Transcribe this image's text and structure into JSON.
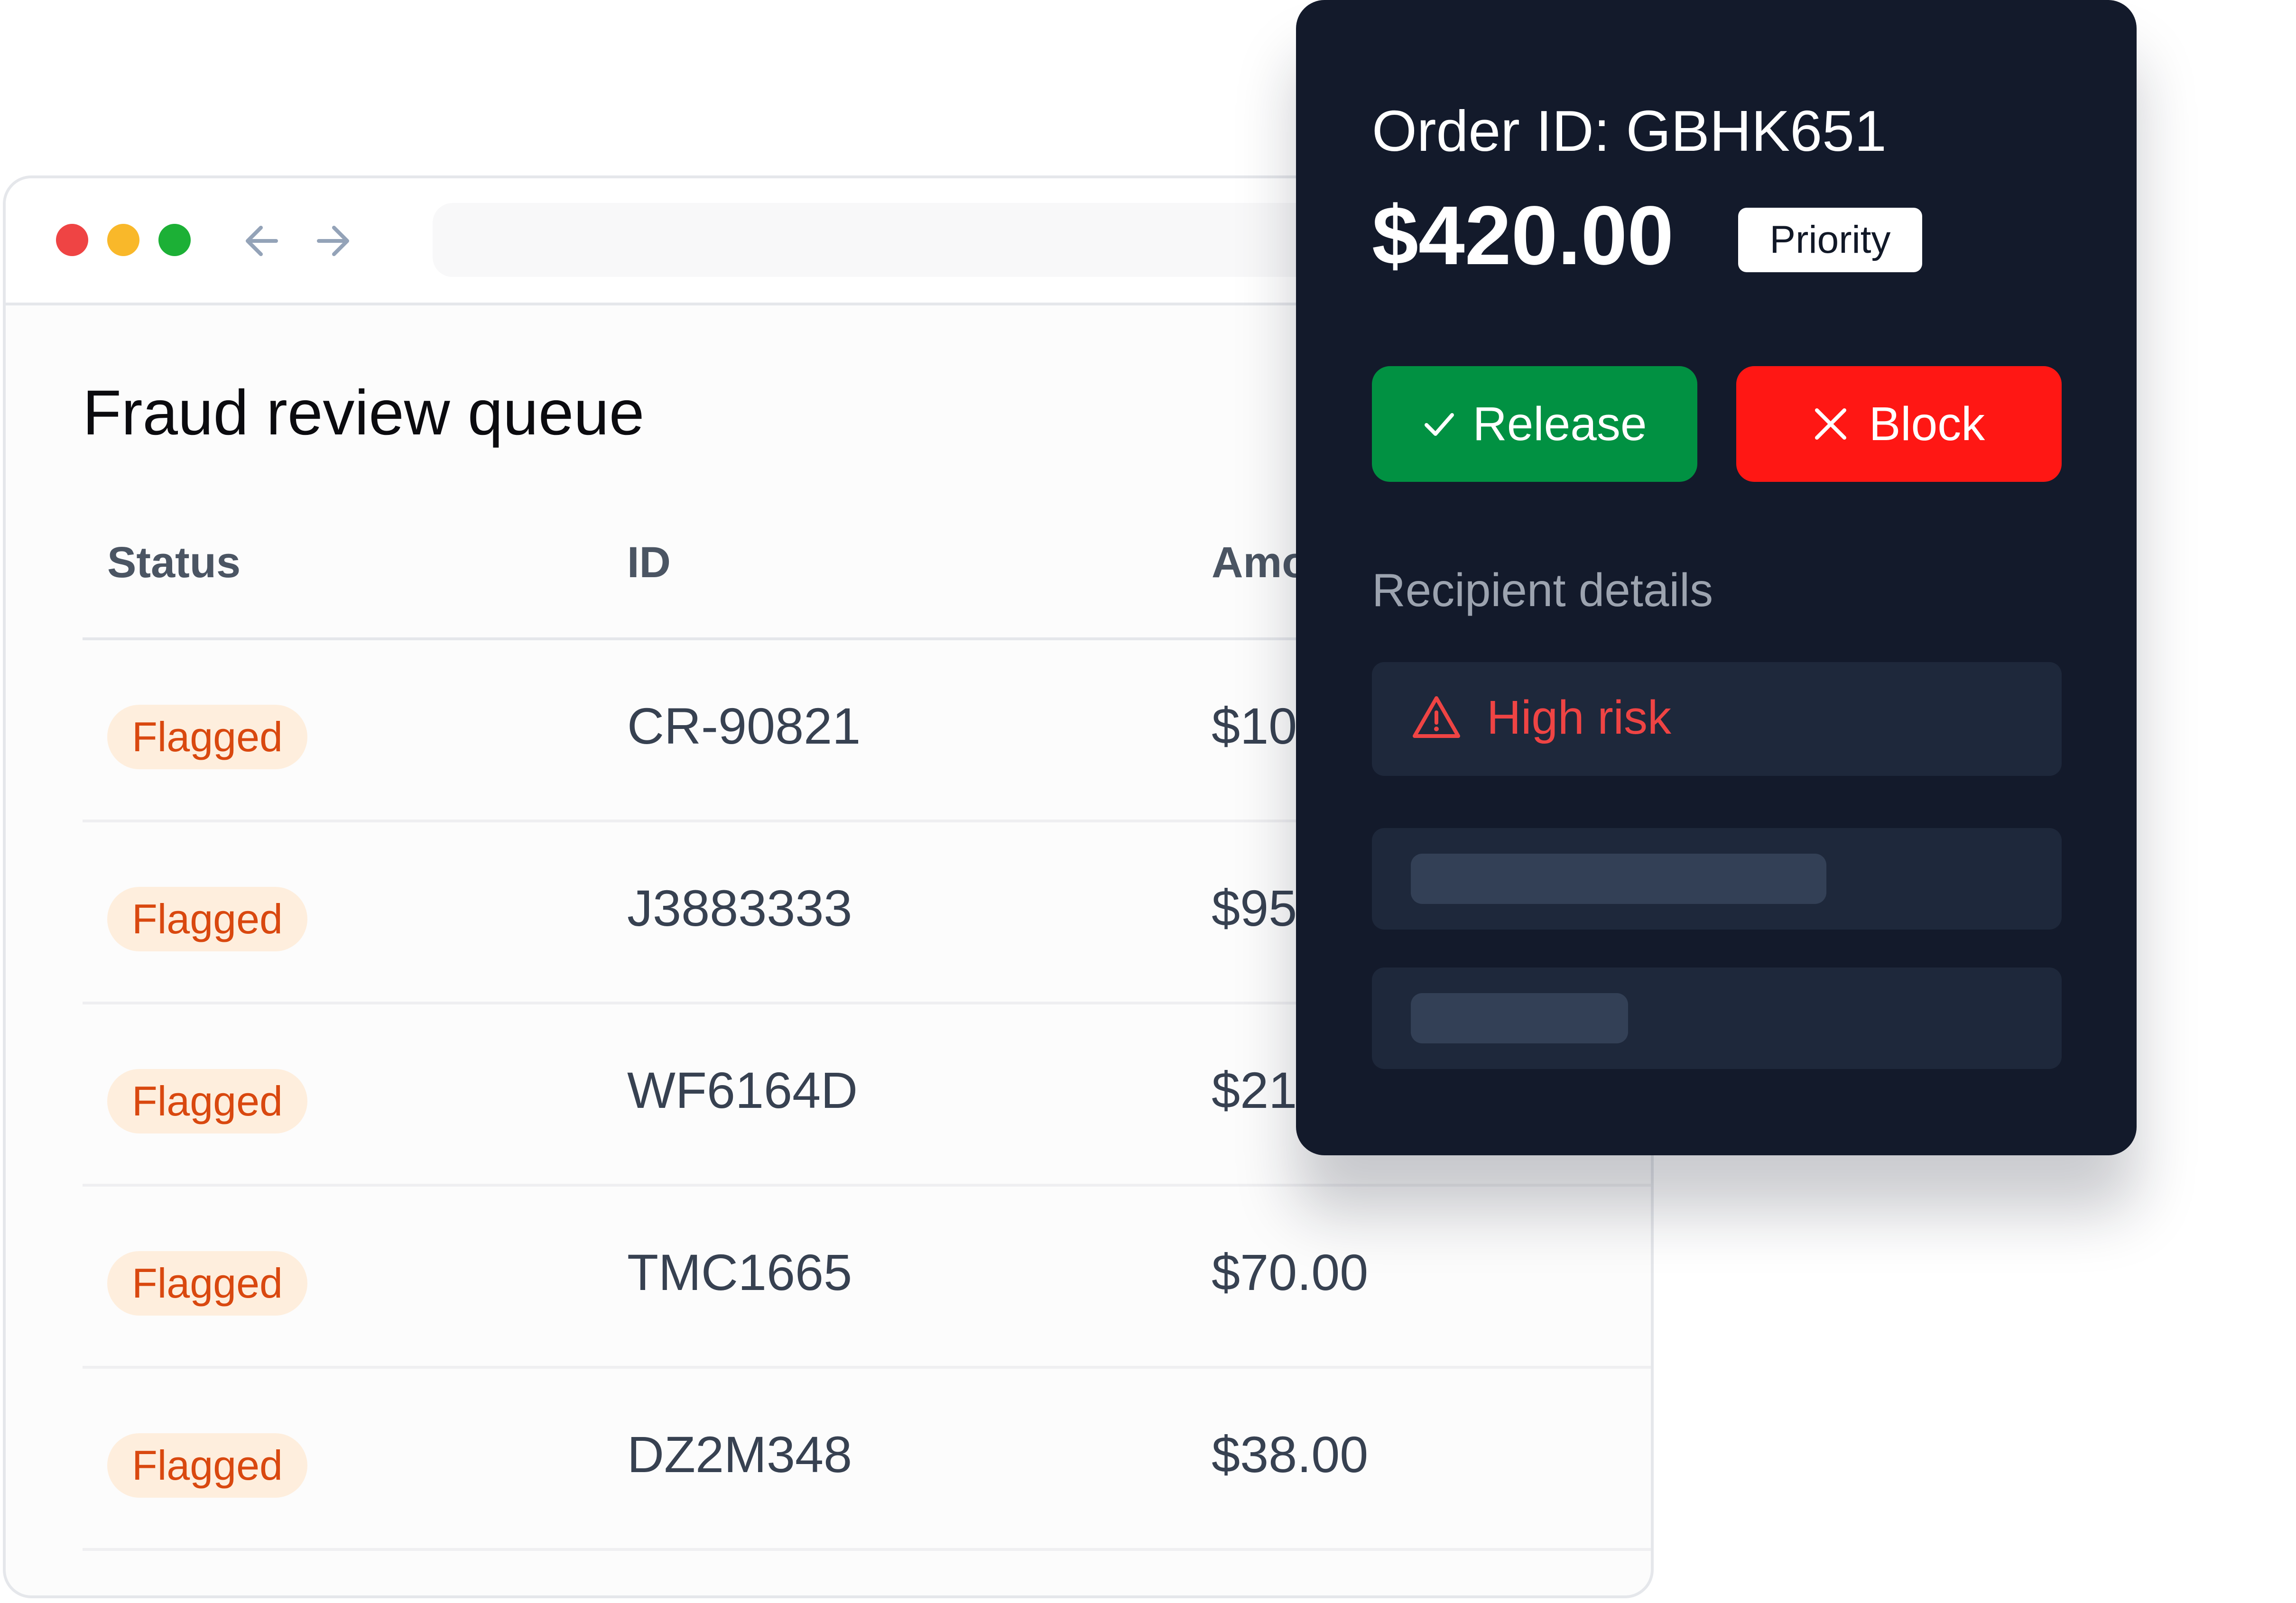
{
  "queue": {
    "title": "Fraud review queue",
    "columns": {
      "status": "Status",
      "id": "ID",
      "amount": "Amo"
    },
    "rows": [
      {
        "status": "Flagged",
        "id": "CR-90821",
        "amount": "$10"
      },
      {
        "status": "Flagged",
        "id": "J3883333",
        "amount": "$95"
      },
      {
        "status": "Flagged",
        "id": "WF6164D",
        "amount": "$21"
      },
      {
        "status": "Flagged",
        "id": "TMC1665",
        "amount": "$70.00"
      },
      {
        "status": "Flagged",
        "id": "DZ2M348",
        "amount": "$38.00"
      }
    ]
  },
  "detail": {
    "order_id": "Order ID: GBHK651",
    "amount": "$420.00",
    "tag": "Priority",
    "release_label": "Release",
    "block_label": "Block",
    "section_label": "Recipient details",
    "risk_label": "High risk"
  },
  "icons": {
    "back": "arrow-left-icon",
    "forward": "arrow-right-icon",
    "release": "check-icon",
    "block": "x-icon",
    "risk": "warning-triangle-icon"
  },
  "colors": {
    "panel_bg": "#131a2b",
    "release": "#019142",
    "block": "#ff1714",
    "risk": "#ef4444",
    "flag_bg": "#feeedd",
    "flag_text": "#d9480f"
  }
}
